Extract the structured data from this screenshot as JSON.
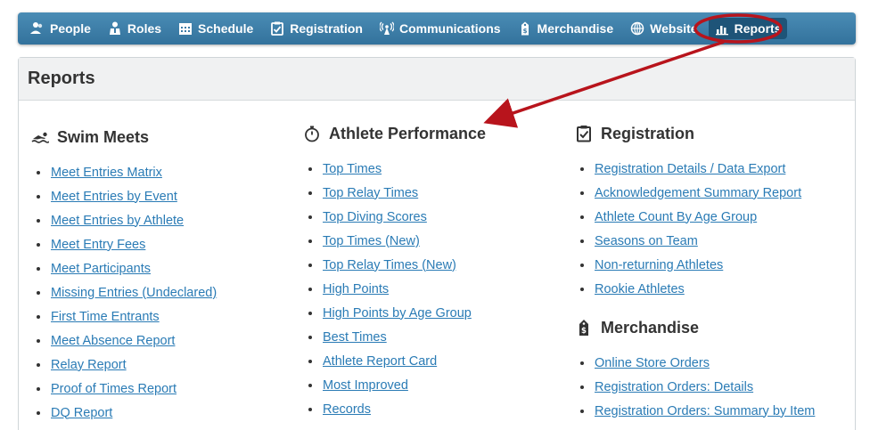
{
  "nav": {
    "items": [
      {
        "id": "people",
        "label": "People",
        "icon": "people-icon"
      },
      {
        "id": "roles",
        "label": "Roles",
        "icon": "roles-icon"
      },
      {
        "id": "schedule",
        "label": "Schedule",
        "icon": "calendar-icon"
      },
      {
        "id": "registration",
        "label": "Registration",
        "icon": "clipboard-check-icon"
      },
      {
        "id": "communications",
        "label": "Communications",
        "icon": "broadcast-icon"
      },
      {
        "id": "merchandise",
        "label": "Merchandise",
        "icon": "price-tag-icon"
      },
      {
        "id": "website",
        "label": "Website",
        "icon": "globe-icon"
      },
      {
        "id": "reports",
        "label": "Reports",
        "icon": "bar-chart-icon",
        "active": true
      }
    ]
  },
  "panel": {
    "title": "Reports"
  },
  "sections": {
    "swim_meets": {
      "title": "Swim Meets",
      "icon": "swimmer-icon",
      "links": [
        "Meet Entries Matrix",
        "Meet Entries by Event",
        "Meet Entries by Athlete",
        "Meet Entry Fees",
        "Meet Participants",
        "Missing Entries (Undeclared)",
        "First Time Entrants",
        "Meet Absence Report",
        "Relay Report",
        "Proof of Times Report",
        "DQ Report"
      ]
    },
    "athlete_performance": {
      "title": "Athlete Performance",
      "icon": "stopwatch-icon",
      "links": [
        "Top Times",
        "Top Relay Times",
        "Top Diving Scores",
        "Top Times (New)",
        "Top Relay Times (New)",
        "High Points",
        "High Points by Age Group",
        "Best Times",
        "Athlete Report Card",
        "Most Improved",
        "Records"
      ]
    },
    "registration": {
      "title": "Registration",
      "icon": "clipboard-check-icon",
      "links": [
        "Registration Details / Data Export",
        "Acknowledgement Summary Report",
        "Athlete Count By Age Group",
        "Seasons on Team",
        "Non-returning Athletes",
        "Rookie Athletes"
      ]
    },
    "merchandise": {
      "title": "Merchandise",
      "icon": "price-tag-icon",
      "links": [
        "Online Store Orders",
        "Registration Orders: Details",
        "Registration Orders: Summary by Item"
      ]
    }
  },
  "annotation": {
    "color": "#b8141c"
  }
}
